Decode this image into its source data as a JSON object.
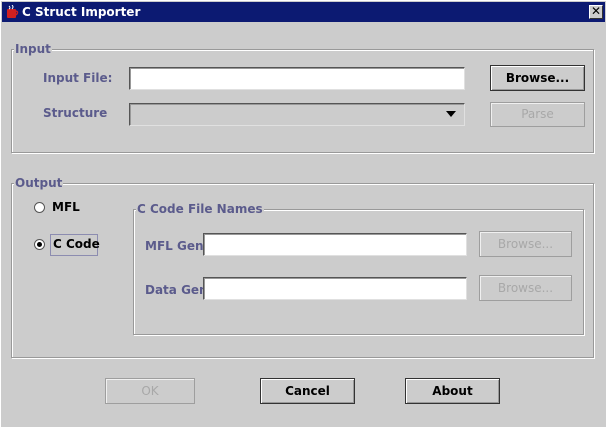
{
  "window": {
    "title": "C Struct Importer",
    "close_glyph": "✕",
    "icon": "java-cup-icon"
  },
  "input_group": {
    "title": "Input",
    "input_file_label": "Input File:",
    "input_file_value": "",
    "browse_label": "Browse...",
    "structure_label": "Structure",
    "structure_value": "",
    "parse_label": "Parse"
  },
  "output_group": {
    "title": "Output",
    "mfl_label": "MFL",
    "ccode_label": "C Code",
    "selected": "C Code",
    "file_names": {
      "title": "C Code File Names",
      "mfl_gen_label": "MFL Gen:",
      "mfl_gen_value": "",
      "mfl_browse_label": "Browse...",
      "data_gen_label": "Data Gen:",
      "data_gen_value": "",
      "data_browse_label": "Browse..."
    }
  },
  "footer": {
    "ok_label": "OK",
    "cancel_label": "Cancel",
    "about_label": "About"
  },
  "colors": {
    "titlebar": "#0c1a72",
    "panel": "#cccccc",
    "label": "#5b5b8c"
  }
}
